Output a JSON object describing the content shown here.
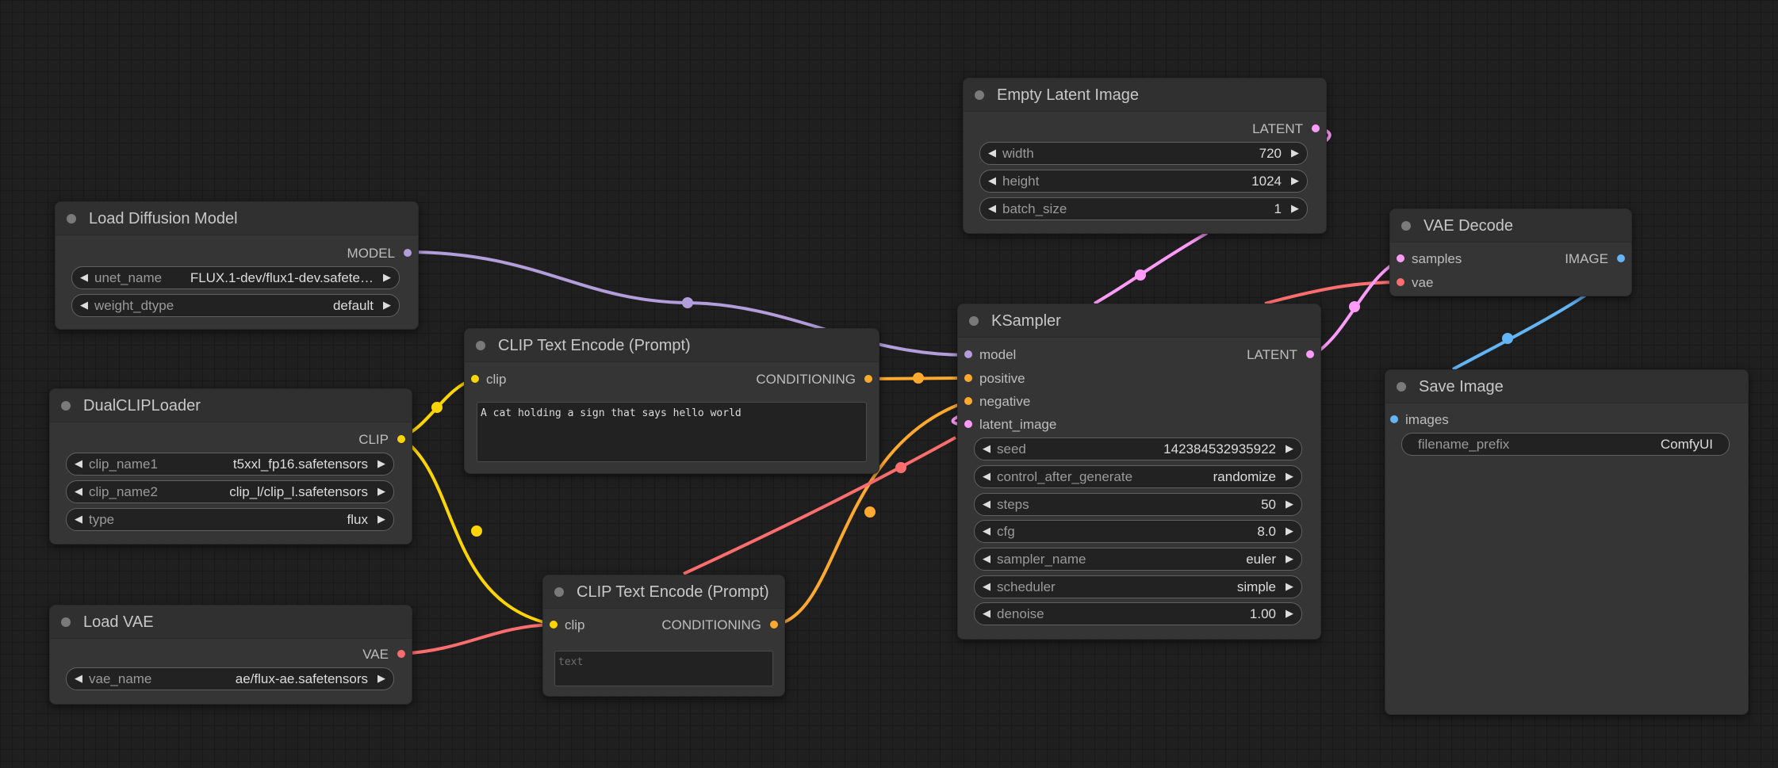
{
  "colors": {
    "model": "#b39ddb",
    "clip": "#ffd500",
    "conditioning": "#ffa931",
    "latent": "#ff9cf9",
    "vae": "#ff6e6e",
    "image": "#64b5f6"
  },
  "nodes": {
    "load_diffusion": {
      "title": "Load Diffusion Model",
      "output": "MODEL",
      "widgets": [
        {
          "label": "unet_name",
          "value": "FLUX.1-dev/flux1-dev.safete…"
        },
        {
          "label": "weight_dtype",
          "value": "default"
        }
      ]
    },
    "dual_clip": {
      "title": "DualCLIPLoader",
      "output": "CLIP",
      "widgets": [
        {
          "label": "clip_name1",
          "value": "t5xxl_fp16.safetensors"
        },
        {
          "label": "clip_name2",
          "value": "clip_l/clip_l.safetensors"
        },
        {
          "label": "type",
          "value": "flux"
        }
      ]
    },
    "load_vae": {
      "title": "Load VAE",
      "output": "VAE",
      "widgets": [
        {
          "label": "vae_name",
          "value": "ae/flux-ae.safetensors"
        }
      ]
    },
    "clip_pos": {
      "title": "CLIP Text Encode (Prompt)",
      "input": "clip",
      "output": "CONDITIONING",
      "text": "A cat holding a sign that says hello world"
    },
    "clip_neg": {
      "title": "CLIP Text Encode (Prompt)",
      "input": "clip",
      "output": "CONDITIONING",
      "placeholder": "text"
    },
    "empty_latent": {
      "title": "Empty Latent Image",
      "output": "LATENT",
      "widgets": [
        {
          "label": "width",
          "value": "720"
        },
        {
          "label": "height",
          "value": "1024"
        },
        {
          "label": "batch_size",
          "value": "1"
        }
      ]
    },
    "ksampler": {
      "title": "KSampler",
      "inputs": [
        "model",
        "positive",
        "negative",
        "latent_image"
      ],
      "output": "LATENT",
      "widgets": [
        {
          "label": "seed",
          "value": "142384532935922"
        },
        {
          "label": "control_after_generate",
          "value": "randomize"
        },
        {
          "label": "steps",
          "value": "50"
        },
        {
          "label": "cfg",
          "value": "8.0"
        },
        {
          "label": "sampler_name",
          "value": "euler"
        },
        {
          "label": "scheduler",
          "value": "simple"
        },
        {
          "label": "denoise",
          "value": "1.00"
        }
      ]
    },
    "vae_decode": {
      "title": "VAE Decode",
      "inputs": [
        "samples",
        "vae"
      ],
      "output": "IMAGE"
    },
    "save_image": {
      "title": "Save Image",
      "input": "images",
      "widgets": [
        {
          "label": "filename_prefix",
          "value": "ComfyUI"
        }
      ]
    }
  }
}
